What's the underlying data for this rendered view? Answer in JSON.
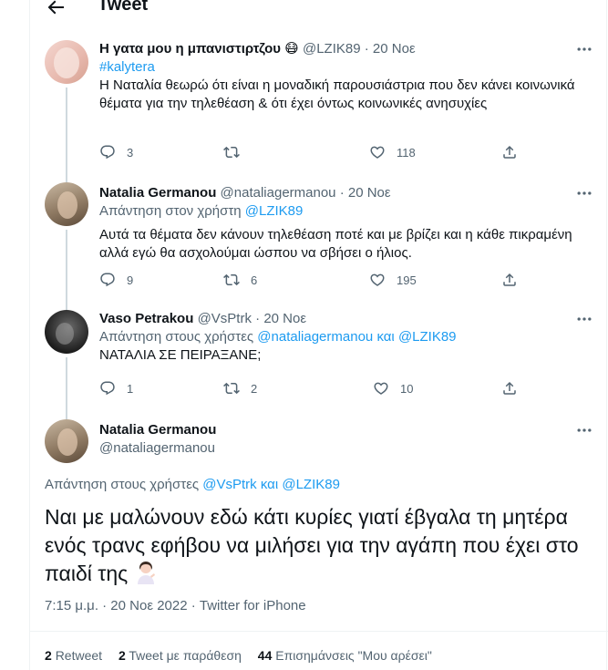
{
  "header": {
    "title": "Tweet"
  },
  "replies": [
    {
      "name": "Η γατα μου η μπανιστιρτζου",
      "handle": "@LZIK89",
      "date": "20 Νοε",
      "hashtag": "#kalytera",
      "text": "Η Ναταλία θεωρώ ότι είναι η μοναδική παρουσιάστρια που δεν κάνει κοινωνικά θέματα για την τηλεθέαση & ότι έχει όντως κοινωνικές ανησυχίες",
      "stats": {
        "replies": "3",
        "retweets": "",
        "likes": "118"
      }
    },
    {
      "name": "Natalia Germanou",
      "handle": "@nataliagermanou",
      "date": "20 Νοε",
      "reply_prefix": "Απάντηση στον χρήστη",
      "reply_to": "@LZIK89",
      "text": "Αυτά τα θέματα δεν κάνουν τηλεθέαση ποτέ και με βρίζει και η κάθε πικραμένη αλλά εγώ θα ασχολούμαι ώσπου να σβήσει ο ήλιος.",
      "stats": {
        "replies": "9",
        "retweets": "6",
        "likes": "195"
      }
    },
    {
      "name": "Vaso Petrakou",
      "handle": "@VsPtrk",
      "date": "20 Νοε",
      "reply_prefix": "Απάντηση στους χρήστες",
      "reply_to_1": "@nataliagermanou",
      "reply_and": "και",
      "reply_to_2": "@LZIK89",
      "text": "ΝΑΤΑΛΙΑ ΣΕ ΠΕΙΡΑΞΑΝΕ;",
      "stats": {
        "replies": "1",
        "retweets": "2",
        "likes": "10"
      }
    }
  ],
  "main": {
    "name": "Natalia Germanou",
    "handle": "@nataliagermanou",
    "reply_prefix": "Απάντηση στους χρήστες",
    "reply_to_1": "@VsPtrk",
    "reply_and": "και",
    "reply_to_2": "@LZIK89",
    "text": "Ναι με μαλώνουν εδώ κάτι κυρίες γιατί έβγαλα τη μητέρα ενός τρανς εφήβου να μιλήσει για την αγάπη που έχει στο παιδί της",
    "timestamp": "7:15 μ.μ. · 20 Νοε 2022 · Twitter for iPhone",
    "retweets_count": "2",
    "retweets_label": "Retweet",
    "quotes_count": "2",
    "quotes_label": "Tweet με παράθεση",
    "likes_count": "44",
    "likes_label": "Επισημάνσεις \"Μου αρέσει\""
  },
  "colors": {
    "accent": "#1d9bf0",
    "muted": "#536471",
    "text": "#0f1419"
  }
}
